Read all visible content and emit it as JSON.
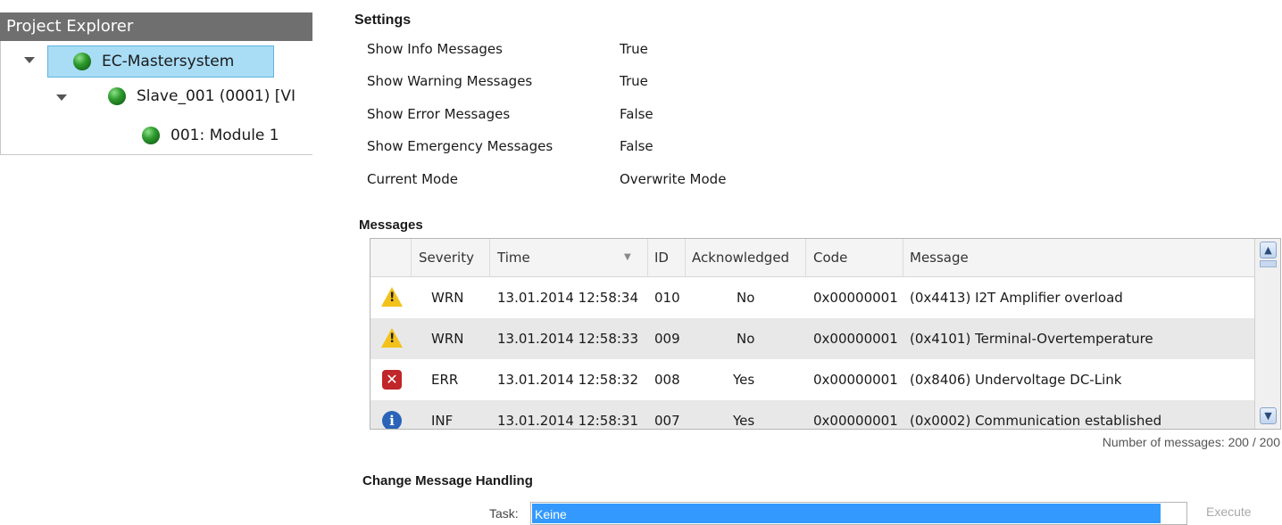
{
  "project_explorer": {
    "title": "Project Explorer",
    "tree": [
      {
        "label": "EC-Mastersystem",
        "status": "green",
        "selected": true
      },
      {
        "label": "Slave_001 (0001) [VI",
        "status": "green"
      },
      {
        "label": "001: Module 1",
        "status": "green"
      }
    ]
  },
  "settings": {
    "title": "Settings",
    "rows": [
      {
        "label": "Show Info Messages",
        "value": "True"
      },
      {
        "label": "Show Warning Messages",
        "value": "True"
      },
      {
        "label": "Show Error Messages",
        "value": "False"
      },
      {
        "label": "Show Emergency Messages",
        "value": "False"
      },
      {
        "label": "Current Mode",
        "value": "Overwrite Mode"
      }
    ]
  },
  "messages": {
    "title": "Messages",
    "columns": [
      "Severity",
      "Time",
      "ID",
      "Acknowledged",
      "Code",
      "Message"
    ],
    "rows": [
      {
        "icon": "warning-icon",
        "severity": "WRN",
        "time": "13.01.2014 12:58:34",
        "id": "010",
        "ack": "No",
        "code": "0x00000001",
        "message": "(0x4413) I2T Amplifier overload"
      },
      {
        "icon": "warning-icon",
        "severity": "WRN",
        "time": "13.01.2014 12:58:33",
        "id": "009",
        "ack": "No",
        "code": "0x00000001",
        "message": "(0x4101) Terminal-Overtemperature"
      },
      {
        "icon": "error-icon",
        "severity": "ERR",
        "time": "13.01.2014 12:58:32",
        "id": "008",
        "ack": "Yes",
        "code": "0x00000001",
        "message": "(0x8406) Undervoltage DC-Link"
      },
      {
        "icon": "info-icon",
        "severity": "INF",
        "time": "13.01.2014 12:58:31",
        "id": "007",
        "ack": "Yes",
        "code": "0x00000001",
        "message": "(0x0002) Communication established"
      }
    ],
    "count_text": "Number of messages: 200 / 200"
  },
  "change_handling": {
    "title": "Change Message Handling",
    "task_label": "Task:",
    "task_value": "Keine",
    "execute_label": "Execute"
  }
}
